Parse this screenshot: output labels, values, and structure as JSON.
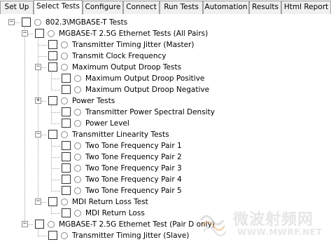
{
  "tabs": [
    {
      "label": "Set Up",
      "active": false
    },
    {
      "label": "Select Tests",
      "active": true
    },
    {
      "label": "Configure",
      "active": false
    },
    {
      "label": "Connect",
      "active": false
    },
    {
      "label": "Run Tests",
      "active": false
    },
    {
      "label": "Automation",
      "active": false
    },
    {
      "label": "Results",
      "active": false
    },
    {
      "label": "Html Report",
      "active": false
    }
  ],
  "tree": [
    {
      "label": "802.3\\MGBASE-T Tests",
      "level": 0,
      "expander": "minus"
    },
    {
      "label": "MGBASE-T 2.5G Ethernet Tests (All Pairs)",
      "level": 1,
      "expander": "minus"
    },
    {
      "label": "Transmitter Timing Jitter (Master)",
      "level": 2,
      "expander": "none"
    },
    {
      "label": "Transmit Clock Frequency",
      "level": 2,
      "expander": "none"
    },
    {
      "label": "Maximum Output Droop Tests",
      "level": 2,
      "expander": "minus"
    },
    {
      "label": "Maximum Output Droop Positive",
      "level": 3,
      "expander": "none"
    },
    {
      "label": "Maximum Output Droop Negative",
      "level": 3,
      "expander": "none"
    },
    {
      "label": "Power Tests",
      "level": 2,
      "expander": "plus"
    },
    {
      "label": "Transmitter Power Spectral Density",
      "level": 3,
      "expander": "none"
    },
    {
      "label": "Power Level",
      "level": 3,
      "expander": "none"
    },
    {
      "label": "Transmitter Linearity Tests",
      "level": 2,
      "expander": "minus"
    },
    {
      "label": "Two Tone Frequency Pair 1",
      "level": 3,
      "expander": "none"
    },
    {
      "label": "Two Tone Frequency Pair 2",
      "level": 3,
      "expander": "none"
    },
    {
      "label": "Two Tone Frequency Pair 3",
      "level": 3,
      "expander": "none"
    },
    {
      "label": "Two Tone Frequency Pair 4",
      "level": 3,
      "expander": "none"
    },
    {
      "label": "Two Tone Frequency Pair 5",
      "level": 3,
      "expander": "none"
    },
    {
      "label": "MDI Return Loss Test",
      "level": 2,
      "expander": "minus"
    },
    {
      "label": "MDI Return Loss",
      "level": 3,
      "expander": "none"
    },
    {
      "label": "MGBASE-T 2.5G Ethernet Test (Pair D only)",
      "level": 1,
      "expander": "minus"
    },
    {
      "label": "Transmitter Timing Jitter (Slave)",
      "level": 2,
      "expander": "none"
    }
  ],
  "watermark": {
    "title": "微波射频网",
    "url": "WWW.MWRF.NET",
    "icon": "mwrf-logo-icon"
  }
}
